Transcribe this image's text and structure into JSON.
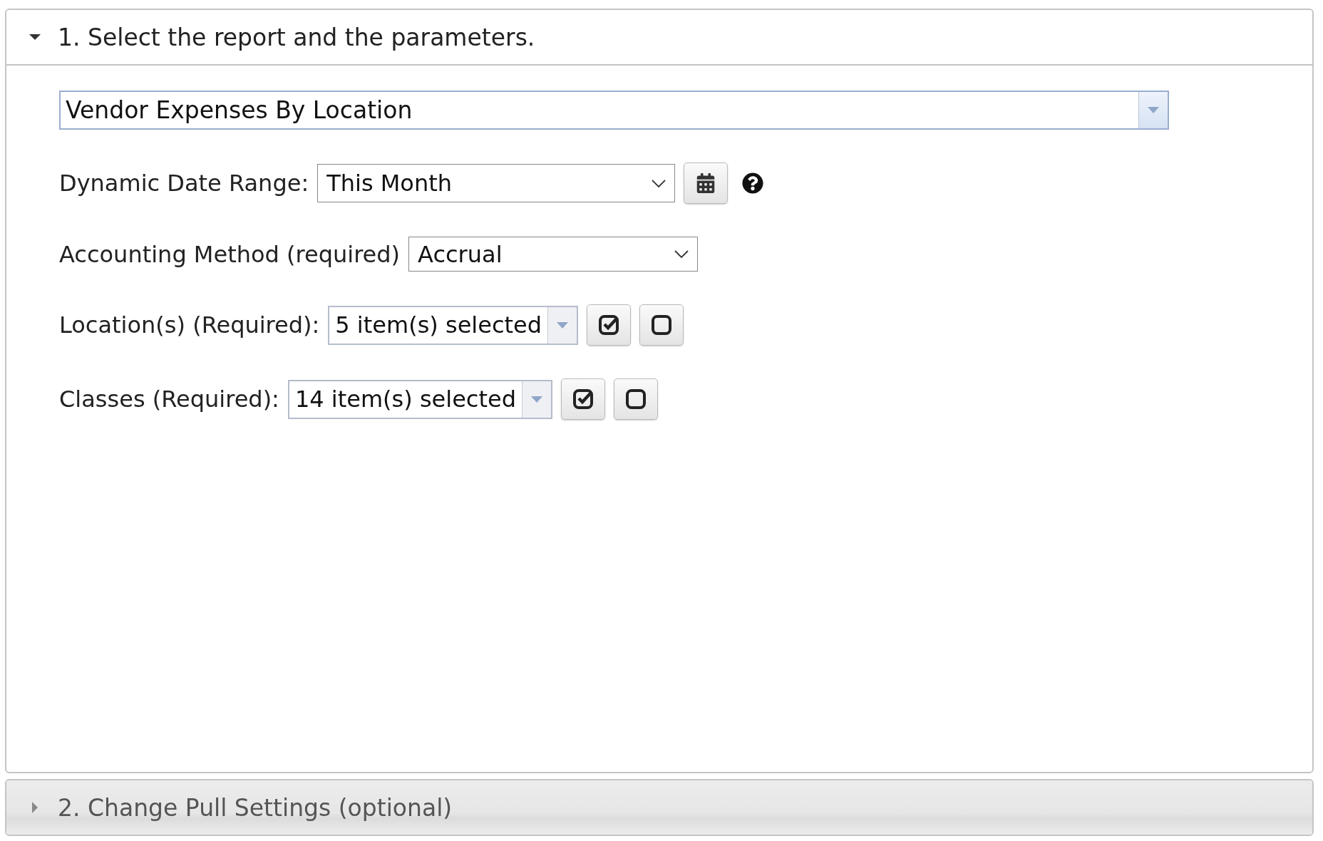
{
  "sections": [
    {
      "title": "1. Select the report and the parameters.",
      "expanded": true,
      "report": {
        "value": "Vendor Expenses By Location"
      },
      "fields": [
        {
          "kind": "select",
          "label": "Dynamic Date Range:",
          "value": "This Month",
          "calendar": true,
          "help": true
        },
        {
          "kind": "select",
          "label": "Accounting Method (required)",
          "value": "Accrual",
          "calendar": false,
          "help": false
        },
        {
          "kind": "multiselect",
          "label": "Location(s) (Required):",
          "value": "5 item(s) selected"
        },
        {
          "kind": "multiselect",
          "label": "Classes (Required):",
          "value": "14 item(s) selected"
        }
      ]
    },
    {
      "title": "2. Change Pull Settings (optional)",
      "expanded": false
    }
  ]
}
